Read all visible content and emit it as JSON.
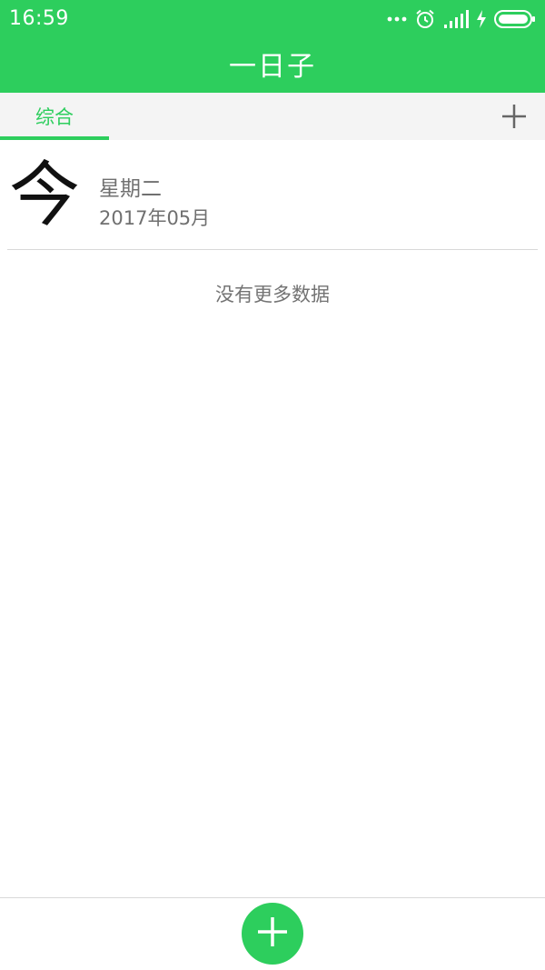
{
  "status_bar": {
    "time": "16:59",
    "icons": [
      "more-dots-icon",
      "alarm-icon",
      "signal-icon",
      "charging-icon",
      "battery-icon"
    ]
  },
  "app_bar": {
    "title": "一日子"
  },
  "tabs": {
    "active_label": "综合",
    "add_icon": "plus-icon"
  },
  "entry": {
    "glyph": "今",
    "weekday": "星期二",
    "month": "2017年05月"
  },
  "list_footer": {
    "message": "没有更多数据"
  },
  "fab": {
    "icon": "plus-icon"
  },
  "colors": {
    "accent": "#2dce5d",
    "tab_background": "#f4f4f4",
    "secondary_text": "#707070",
    "divider": "#d9d9d9"
  }
}
